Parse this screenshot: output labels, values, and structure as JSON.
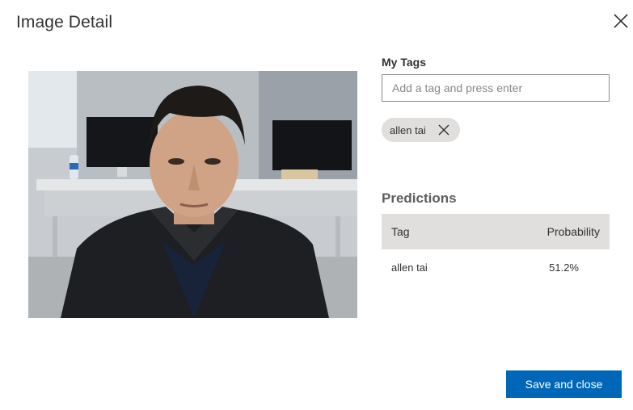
{
  "dialog": {
    "title": "Image Detail"
  },
  "my_tags": {
    "label": "My Tags",
    "input_placeholder": "Add a tag and press enter",
    "input_value": "",
    "chips": [
      {
        "label": "allen tai"
      }
    ]
  },
  "predictions": {
    "title": "Predictions",
    "columns": {
      "tag": "Tag",
      "probability": "Probability"
    },
    "rows": [
      {
        "tag": "allen tai",
        "probability": "51.2%"
      }
    ]
  },
  "actions": {
    "save_label": "Save and close"
  },
  "colors": {
    "primary": "#0067b8",
    "chip_bg": "#e1dfdd",
    "table_header_bg": "#e1dfdd",
    "text": "#323130"
  }
}
